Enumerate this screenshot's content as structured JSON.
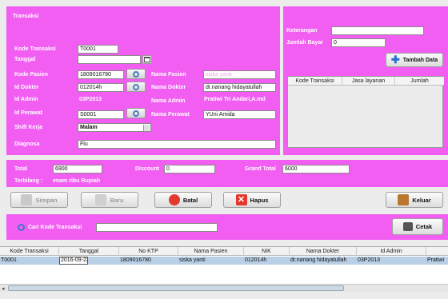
{
  "form": {
    "title": "Transaksi",
    "kode_transaksi_label": "Kode Transaksi",
    "kode_transaksi_value": "T0001",
    "tanggal_label": "Tanggal",
    "tanggal_value": "",
    "kode_pasien_label": "Kode Pasien",
    "kode_pasien_value": "1809016780",
    "nama_pasien_label": "Nama Pasien",
    "nama_pasien_value": "siska yanti",
    "id_dokter_label": "Id Dokter",
    "id_dokter_value": "012014h",
    "nama_dokter_label": "Nama Dokter",
    "nama_dokter_value": "dr.nanang hidayatullah",
    "id_admin_label": "Id Admin",
    "id_admin_value": "03P2013",
    "nama_admin_label": "Nama Admin",
    "nama_admin_value": "Pratiwi Tri Andari,A.md",
    "id_perawat_label": "Id Perawat",
    "id_perawat_value": "S0001",
    "nama_perawat_label": "Nama Perawat",
    "nama_perawat_value": "YUni Amida",
    "shift_label": "Shift Kerja",
    "shift_value": "Malam",
    "diagnosa_label": "Diagnosa",
    "diagnosa_value": "Flu"
  },
  "payment": {
    "keterangan_label": "Keterangan",
    "keterangan_value": "",
    "jumlah_bayar_label": "Jumlah Bayar",
    "jumlah_bayar_value": "0",
    "tambah_label": "Tambah Data",
    "service_columns": [
      "Kode Transaksi",
      "Jasa layanan",
      "Jumlah"
    ]
  },
  "totals": {
    "total_label": "Total",
    "total_value": "6900",
    "discount_label": "Discount",
    "discount_value": "0",
    "grand_total_label": "Grand Total",
    "grand_total_value": "6000",
    "terbilang_label": "Terbilang :",
    "terbilang_value": "enam ribu Rupiah"
  },
  "actions": {
    "simpan": "Simpan",
    "baru": "Baru",
    "batal": "Batal",
    "hapus": "Hapus",
    "keluar": "Keluar"
  },
  "search": {
    "label": "Cari Kode Transaksi",
    "value": "",
    "cetak": "Cetak"
  },
  "table": {
    "columns": [
      "Kode Transaksi",
      "Tanggal",
      "No KTP",
      "Nama Pasien",
      "NIK",
      "Nama Dokter",
      "Id Admin"
    ],
    "rows": [
      {
        "kode": "T0001",
        "tanggal": "2016-09-22",
        "ktp": "1809016780",
        "nama": "siska yanti",
        "nik": "012014h",
        "dokter": "dr.nanang hidayatullah",
        "admin": "03P2013",
        "extra": "Pratiwi"
      }
    ]
  },
  "colors": {
    "panel": "#f25ef2",
    "background": "#ececec",
    "selection": "#b8cfe5"
  }
}
